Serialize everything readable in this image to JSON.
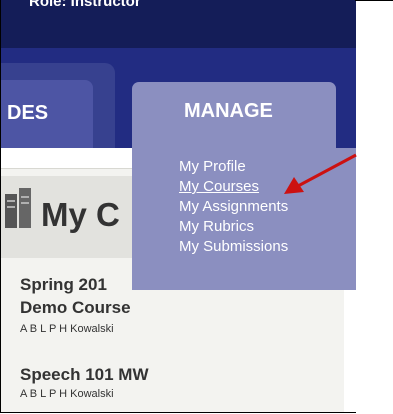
{
  "header": {
    "role_text": "Role: Instructor"
  },
  "nav": {
    "tabs": [
      {
        "label": "DES"
      },
      {
        "label": "MANAGE"
      }
    ],
    "manage_menu": [
      {
        "label": "My Profile"
      },
      {
        "label": "My Courses"
      },
      {
        "label": "My Assignments"
      },
      {
        "label": "My Rubrics"
      },
      {
        "label": "My Submissions"
      }
    ]
  },
  "panel": {
    "title": "My C",
    "courses": [
      {
        "name_line1": "Spring 201",
        "name_line2": "Demo Course",
        "people": "A B L P H Kowalski"
      },
      {
        "name_line1": "Speech 101 MW",
        "people": "A B L P H Kowalski"
      }
    ]
  },
  "colors": {
    "header_bg": "#141d58",
    "nav_bg": "#222c82",
    "manage_bg": "#8b8fc0",
    "arrow": "#cc1111"
  }
}
